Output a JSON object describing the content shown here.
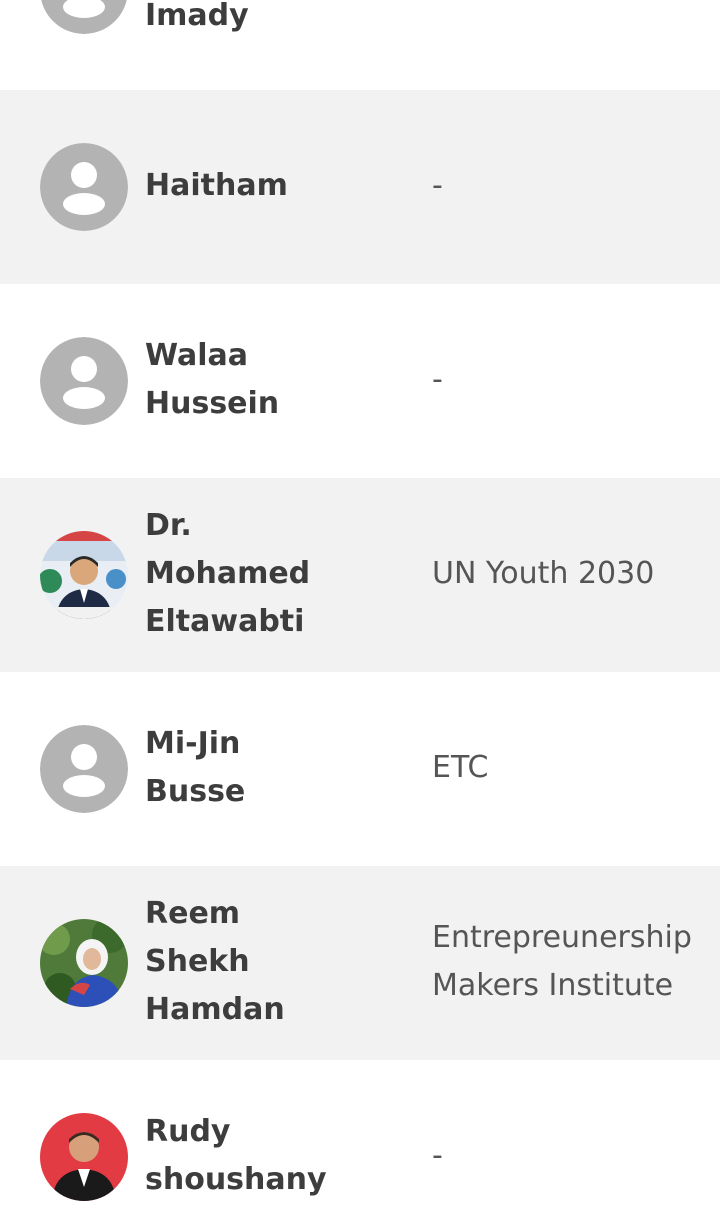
{
  "members": [
    {
      "name": "Imady",
      "org": "",
      "avatar": "default-avatar"
    },
    {
      "name": "Haitham",
      "org": "-",
      "avatar": "default-avatar"
    },
    {
      "name": "Walaa\nHussein",
      "org": "-",
      "avatar": "default-avatar"
    },
    {
      "name": "Dr.\nMohamed\nEltawabti",
      "org": "UN Youth 2030",
      "avatar": "photo"
    },
    {
      "name": "Mi-Jin\nBusse",
      "org": "ETC",
      "avatar": "default-avatar"
    },
    {
      "name": "Reem\nShekh\nHamdan",
      "org": "Entrepreunership\nMakers Institute",
      "avatar": "photo"
    },
    {
      "name": "Rudy\nshoushany",
      "org": "-",
      "avatar": "photo"
    }
  ],
  "colors": {
    "row_alt": "#f2f2f2",
    "divider": "#e3e3e3",
    "name_text": "#3d3d3d",
    "org_text": "#555555",
    "default_avatar": "#b3b3b3"
  }
}
